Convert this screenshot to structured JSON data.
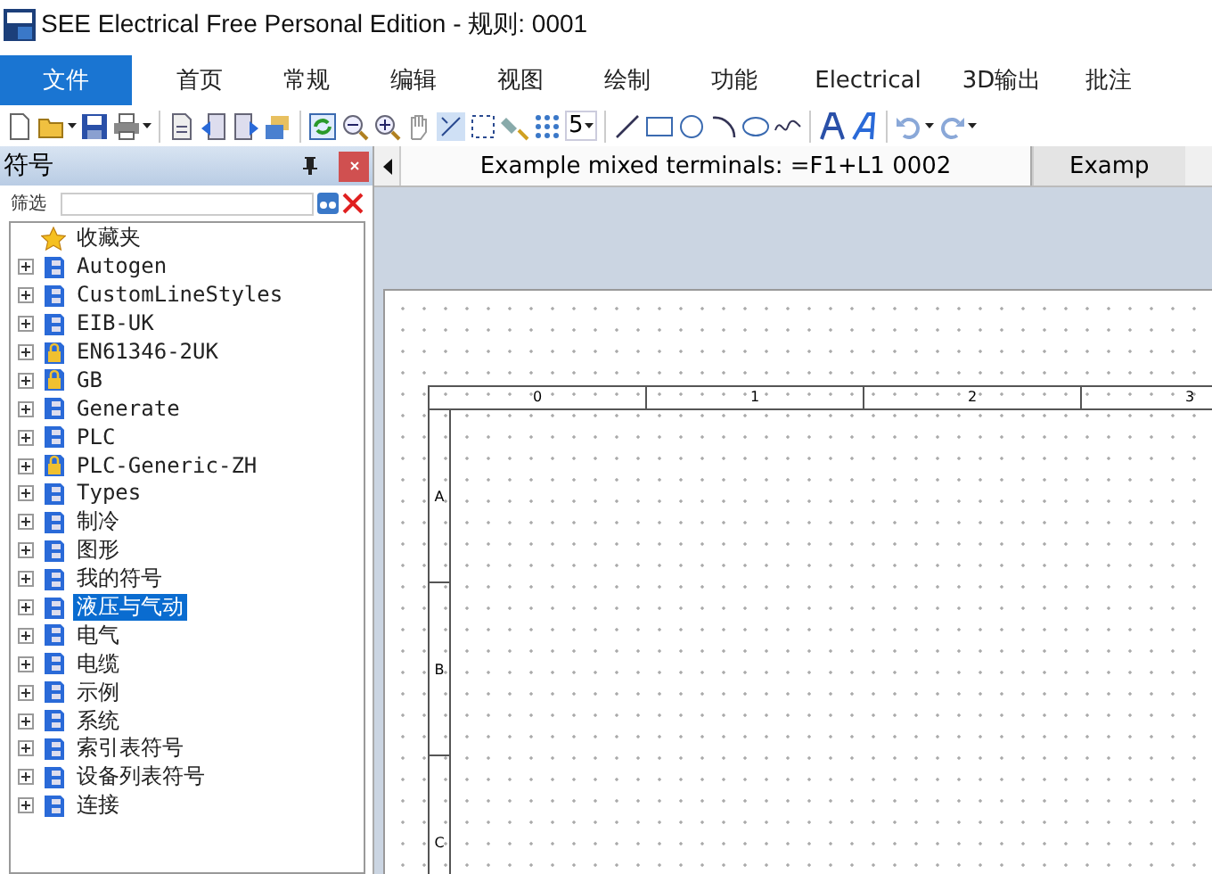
{
  "window": {
    "title": "SEE Electrical Free Personal Edition - 规则: 0001"
  },
  "menu_tabs": [
    {
      "label": "文件",
      "selected": true
    },
    {
      "label": "首页",
      "selected": false
    },
    {
      "label": "常规",
      "selected": false
    },
    {
      "label": "编辑",
      "selected": false
    },
    {
      "label": "视图",
      "selected": false
    },
    {
      "label": "绘制",
      "selected": false
    },
    {
      "label": "功能",
      "selected": false
    },
    {
      "label": "Electrical",
      "selected": false
    },
    {
      "label": "3D输出",
      "selected": false
    },
    {
      "label": "批注",
      "selected": false
    }
  ],
  "toolbar": {
    "grid_size": "5"
  },
  "symbol_panel": {
    "title": "符号",
    "filter_label": "筛选",
    "items": [
      {
        "label": "收藏夹",
        "kind": "favorites",
        "selected": false
      },
      {
        "label": "Autogen",
        "kind": "library",
        "selected": false
      },
      {
        "label": "CustomLineStyles",
        "kind": "library",
        "selected": false
      },
      {
        "label": "EIB-UK",
        "kind": "library",
        "selected": false
      },
      {
        "label": "EN61346-2UK",
        "kind": "locked",
        "selected": false
      },
      {
        "label": "GB",
        "kind": "locked",
        "selected": false
      },
      {
        "label": "Generate",
        "kind": "library",
        "selected": false
      },
      {
        "label": "PLC",
        "kind": "library",
        "selected": false
      },
      {
        "label": "PLC-Generic-ZH",
        "kind": "locked",
        "selected": false
      },
      {
        "label": "Types",
        "kind": "library",
        "selected": false
      },
      {
        "label": "制冷",
        "kind": "library",
        "selected": false
      },
      {
        "label": "图形",
        "kind": "library",
        "selected": false
      },
      {
        "label": "我的符号",
        "kind": "library",
        "selected": false
      },
      {
        "label": "液压与气动",
        "kind": "library",
        "selected": true
      },
      {
        "label": "电气",
        "kind": "library",
        "selected": false
      },
      {
        "label": "电缆",
        "kind": "library",
        "selected": false
      },
      {
        "label": "示例",
        "kind": "library",
        "selected": false
      },
      {
        "label": "系统",
        "kind": "library",
        "selected": false
      },
      {
        "label": "索引表符号",
        "kind": "library",
        "selected": false
      },
      {
        "label": "设备列表符号",
        "kind": "library",
        "selected": false
      },
      {
        "label": "连接",
        "kind": "library",
        "selected": false
      }
    ]
  },
  "document_tabs": [
    {
      "label": "Example mixed terminals: =F1+L1 0002",
      "selected": true
    },
    {
      "label": "Examp",
      "selected": false
    }
  ],
  "drawing": {
    "column_labels": [
      "0",
      "1",
      "2",
      "3"
    ],
    "row_labels": [
      "A",
      "B",
      "C"
    ]
  }
}
